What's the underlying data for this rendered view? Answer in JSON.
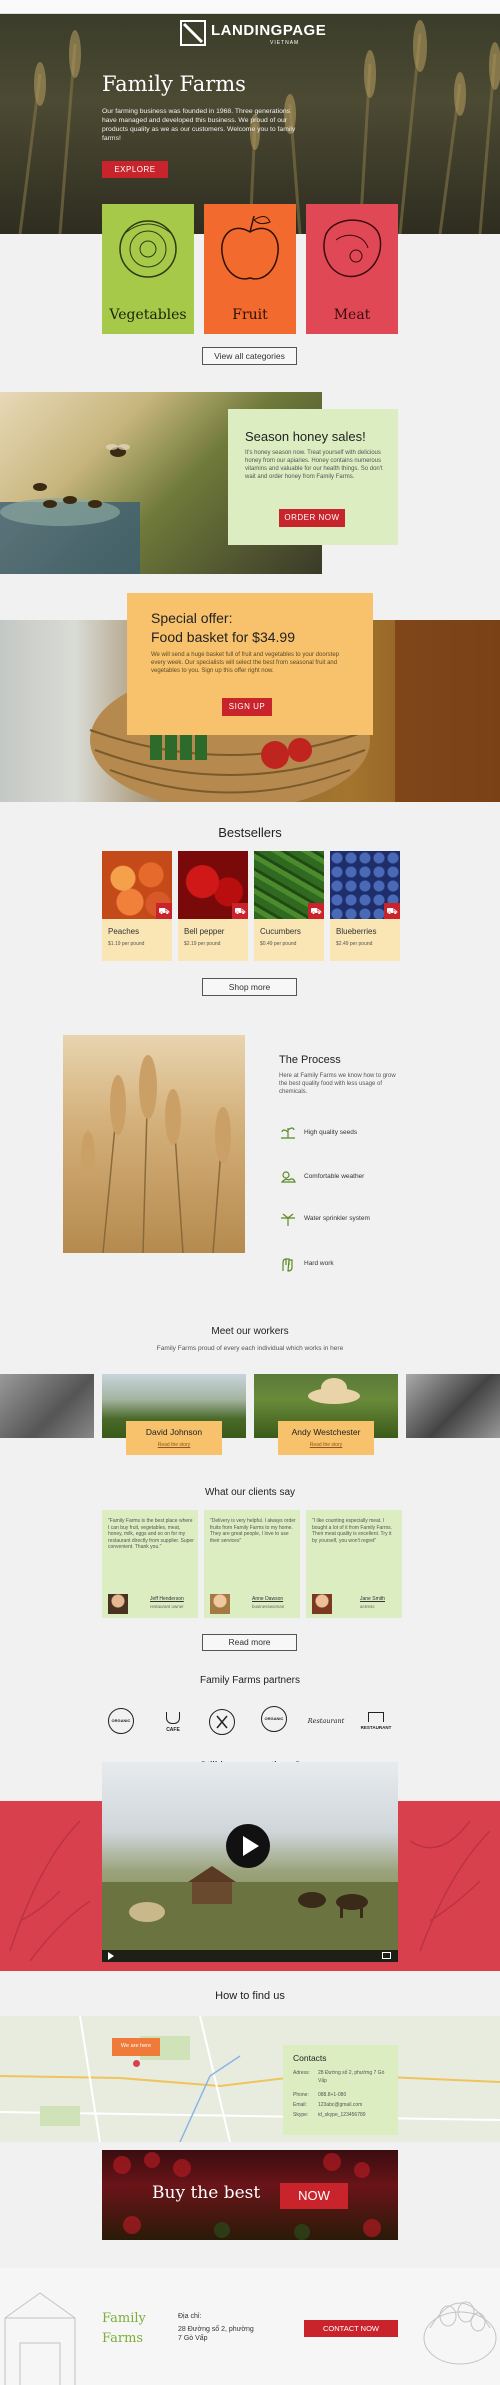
{
  "header": {
    "logo": "LANDINGPAGE",
    "logo_sub": "VIETNAM"
  },
  "hero": {
    "title": "Family Farms",
    "text": "Our farming business was founded in 1968. Three generations have managed and developed this business. We proud of our products quality as we as our customers. Welcome you to family farms!",
    "button": "EXPLORE"
  },
  "categories": {
    "items": [
      {
        "label": "Vegetables"
      },
      {
        "label": "Fruit"
      },
      {
        "label": "Meat"
      }
    ],
    "button": "View all categories"
  },
  "honey": {
    "title": "Season honey sales!",
    "text": "It's honey season now. Treat yourself with delicious honey from our apiaries. Honey contains numerous vitamins and valuable for our health things. So don't wait and order honey from Family Farms.",
    "button": "ORDER NOW"
  },
  "offer": {
    "title": "Special offer:",
    "subtitle": "Food basket for $34.99",
    "text": "We will send a huge basket full of fruit and vegetables to your doorstep every week. Our specialists will select the best from seasonal fruit and vegetables to you. Sign up this offer right now.",
    "button": "SIGN UP"
  },
  "bestsellers": {
    "title": "Bestsellers",
    "items": [
      {
        "name": "Peaches",
        "price": "$1.19 per pound"
      },
      {
        "name": "Bell pepper",
        "price": "$2.19 per pound"
      },
      {
        "name": "Cucumbers",
        "price": "$0.49 per pound"
      },
      {
        "name": "Blueberries",
        "price": "$2.49 per pound"
      }
    ],
    "button": "Shop more"
  },
  "process": {
    "title": "The Process",
    "text": "Here at Family Farms we know how to grow the best quality food with less usage of chemicals.",
    "steps": [
      {
        "label": "High quality seeds"
      },
      {
        "label": "Comfortable weather"
      },
      {
        "label": "Water sprinkler system"
      },
      {
        "label": "Hard work"
      }
    ]
  },
  "workers": {
    "title": "Meet our workers",
    "subtitle": "Family Farms proud of every each individual which works in here",
    "items": [
      {
        "name": "David Johnson",
        "link": "Read the story"
      },
      {
        "name": "Andy Westchester",
        "link": "Read the story"
      }
    ]
  },
  "clients": {
    "title": "What our clients say",
    "items": [
      {
        "quote": "\"Family Farms is the best place where I can buy fruit, vegetables, meat, honey, milk, eggs and so on for my restaurant directly from supplier. Super convenient. Thank you.\"",
        "name": "Jeff Henderson",
        "role": "restaurant owner"
      },
      {
        "quote": "\"Delivery is very helpful. I always order fruits from Family Farms to my home. They are great people, I love to use their services\"",
        "name": "Anne Dawson",
        "role": "businesswoman"
      },
      {
        "quote": "\"I like counting especially meat. I bought a lot of it from Family Farms. Their meat quality is excellent. Try it by yourself, you won't regret\"",
        "name": "Jane Smith",
        "role": "actress"
      }
    ],
    "button": "Read more"
  },
  "partners": {
    "title": "Family Farms partners",
    "logos": [
      "ORGANIC",
      "CAFE",
      "FORK",
      "ORGANIC",
      "Restaurant",
      "RESTAURANT"
    ]
  },
  "video": {
    "title": "Still have questions?",
    "subtitle": "Watch the video about Family Farms"
  },
  "map": {
    "title": "How to find us",
    "pin_label": "We are here",
    "contacts": {
      "title": "Contacts",
      "address_label": "Adress:",
      "address": "28 Đường số 2, phường 7 Gò Vấp",
      "phone_label": "Phone:",
      "phone": "088.8+1-080",
      "email_label": "Email:",
      "email": "123abc@gmail.com",
      "skype_label": "Skype:",
      "skype": "id_skype_123456789"
    }
  },
  "cta": {
    "text": "Buy the best",
    "button": "NOW"
  },
  "footer": {
    "brand": "Family Farms",
    "address_label": "Địa chỉ:",
    "address": "28 Đường số 2, phường 7 Gò Vấp",
    "button": "CONTACT NOW"
  },
  "colors": {
    "red": "#c9242c",
    "green": "#a6c94a",
    "orange": "#f26a2e",
    "rose": "#e04855",
    "yellow": "#f7c26b",
    "cream": "#f9e6b4",
    "lightgreen": "#dcedc1"
  }
}
